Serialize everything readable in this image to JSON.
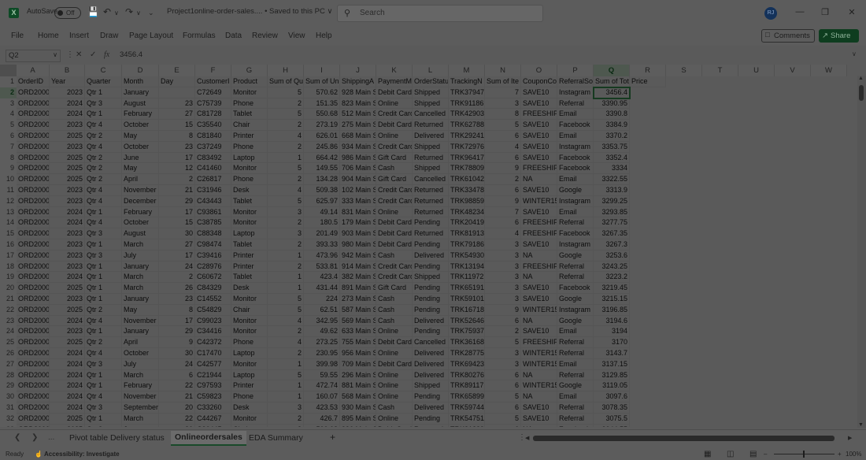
{
  "titlebar": {
    "autosave_label": "AutoSave",
    "autosave_state": "Off",
    "doc_title": "Project1online-order-sales.... • Saved to this PC ∨",
    "search_placeholder": "Search",
    "user_initials": "RJ"
  },
  "icons": {
    "excel": "excel-logo-icon",
    "save": "save-icon",
    "undo": "undo-icon",
    "redo": "redo-icon",
    "customize": "customize-quick-access-icon",
    "search": "search-icon",
    "minimize": "minimize-icon",
    "restore": "restore-icon",
    "close": "close-icon",
    "comments": "comment-icon",
    "share": "share-icon",
    "accessibility": "accessibility-icon"
  },
  "menu": [
    "File",
    "Home",
    "Insert",
    "Draw",
    "Page Layout",
    "Formulas",
    "Data",
    "Review",
    "View",
    "Help"
  ],
  "buttons": {
    "comments": "Comments",
    "share": "Share"
  },
  "formula_bar": {
    "name_box": "Q2",
    "formula": "3456.4",
    "fx": "fx"
  },
  "columns": [
    "A",
    "B",
    "C",
    "D",
    "E",
    "F",
    "G",
    "H",
    "I",
    "J",
    "K",
    "L",
    "M",
    "N",
    "O",
    "P",
    "Q",
    "R",
    "S",
    "T",
    "U",
    "V",
    "W"
  ],
  "selected_column": "Q",
  "selected_row": "2",
  "header_row": [
    "OrderID",
    "Year",
    "Quarter",
    "Month",
    "Day",
    "CustomerI",
    "Product",
    "Sum of Qu",
    "Sum of Un",
    "ShippingA",
    "PaymentM",
    "OrderStatu",
    "TrackingN",
    "Sum of Ite",
    "CouponCo",
    "ReferralSo",
    "Sum of Total",
    "Price"
  ],
  "rows": [
    [
      "ORD20000",
      "2023",
      "Qtr 1",
      "January",
      "",
      "C72649",
      "Monitor",
      "5",
      "570.62",
      "928 Main S",
      "Debit Card",
      "Shipped",
      "TRK37947",
      "7",
      "SAVE10",
      "Instagram",
      "3456.4"
    ],
    [
      "ORD20000",
      "2024",
      "Qtr 3",
      "August",
      "23",
      "C75739",
      "Phone",
      "2",
      "151.35",
      "823 Main S",
      "Online",
      "Shipped",
      "TRK91186",
      "3",
      "SAVE10",
      "Referral",
      "3390.95"
    ],
    [
      "ORD20000",
      "2024",
      "Qtr 1",
      "February",
      "27",
      "C81728",
      "Tablet",
      "5",
      "550.68",
      "512 Main S",
      "Credit Card",
      "Cancelled",
      "TRK42903",
      "8",
      "FREESHIP",
      "Email",
      "3390.8"
    ],
    [
      "ORD20000",
      "2023",
      "Qtr 4",
      "October",
      "15",
      "C35540",
      "Chair",
      "2",
      "273.19",
      "275 Main S",
      "Debit Card",
      "Returned",
      "TRK62788",
      "5",
      "SAVE10",
      "Facebook",
      "3384.9"
    ],
    [
      "ORD20000",
      "2025",
      "Qtr 2",
      "May",
      "8",
      "C81840",
      "Printer",
      "4",
      "626.01",
      "668 Main S",
      "Online",
      "Delivered",
      "TRK29241",
      "6",
      "SAVE10",
      "Email",
      "3370.2"
    ],
    [
      "ORD20000",
      "2023",
      "Qtr 4",
      "October",
      "23",
      "C37249",
      "Phone",
      "2",
      "245.86",
      "934 Main S",
      "Credit Card",
      "Shipped",
      "TRK72976",
      "4",
      "SAVE10",
      "Instagram",
      "3353.75"
    ],
    [
      "ORD20000",
      "2025",
      "Qtr 2",
      "June",
      "17",
      "C83492",
      "Laptop",
      "1",
      "664.42",
      "986 Main S",
      "Gift Card",
      "Returned",
      "TRK96417",
      "6",
      "SAVE10",
      "Facebook",
      "3352.4"
    ],
    [
      "ORD20000",
      "2025",
      "Qtr 2",
      "May",
      "12",
      "C41460",
      "Monitor",
      "5",
      "149.55",
      "706 Main S",
      "Cash",
      "Shipped",
      "TRK78809",
      "9",
      "FREESHIP",
      "Facebook",
      "3334"
    ],
    [
      "ORD20000",
      "2025",
      "Qtr 2",
      "April",
      "2",
      "C26817",
      "Phone",
      "2",
      "134.28",
      "904 Main S",
      "Gift Card",
      "Cancelled",
      "TRK61042",
      "2",
      "NA",
      "Email",
      "3322.55"
    ],
    [
      "ORD20000",
      "2023",
      "Qtr 4",
      "November",
      "21",
      "C31946",
      "Desk",
      "4",
      "509.38",
      "102 Main S",
      "Credit Card",
      "Returned",
      "TRK33478",
      "6",
      "SAVE10",
      "Google",
      "3313.9"
    ],
    [
      "ORD20001",
      "2023",
      "Qtr 4",
      "December",
      "29",
      "C43443",
      "Tablet",
      "5",
      "625.97",
      "333 Main S",
      "Credit Card",
      "Returned",
      "TRK98859",
      "9",
      "WINTER15",
      "Instagram",
      "3299.25"
    ],
    [
      "ORD20001",
      "2024",
      "Qtr 1",
      "February",
      "17",
      "C93861",
      "Monitor",
      "3",
      "49.14",
      "831 Main S",
      "Online",
      "Returned",
      "TRK48234",
      "7",
      "SAVE10",
      "Email",
      "3293.85"
    ],
    [
      "ORD20001",
      "2024",
      "Qtr 4",
      "October",
      "15",
      "C38785",
      "Monitor",
      "2",
      "180.5",
      "179 Main S",
      "Debit Card",
      "Pending",
      "TRK20419",
      "6",
      "FREESHIP",
      "Referral",
      "3277.75"
    ],
    [
      "ORD20001",
      "2023",
      "Qtr 3",
      "August",
      "30",
      "C88348",
      "Laptop",
      "3",
      "201.49",
      "903 Main S",
      "Debit Card",
      "Returned",
      "TRK81913",
      "4",
      "FREESHIP",
      "Facebook",
      "3267.35"
    ],
    [
      "ORD20001",
      "2023",
      "Qtr 1",
      "March",
      "27",
      "C98474",
      "Tablet",
      "2",
      "393.33",
      "980 Main S",
      "Debit Card",
      "Pending",
      "TRK79186",
      "3",
      "SAVE10",
      "Instagram",
      "3267.3"
    ],
    [
      "ORD20001",
      "2023",
      "Qtr 3",
      "July",
      "17",
      "C39416",
      "Printer",
      "1",
      "473.96",
      "942 Main S",
      "Cash",
      "Delivered",
      "TRK54930",
      "3",
      "NA",
      "Google",
      "3253.6"
    ],
    [
      "ORD20001",
      "2023",
      "Qtr 1",
      "January",
      "24",
      "C28976",
      "Printer",
      "2",
      "533.81",
      "914 Main S",
      "Credit Card",
      "Pending",
      "TRK13194",
      "3",
      "FREESHIP",
      "Referral",
      "3243.25"
    ],
    [
      "ORD20001",
      "2024",
      "Qtr 1",
      "March",
      "2",
      "C60672",
      "Tablet",
      "1",
      "423.4",
      "382 Main S",
      "Credit Card",
      "Shipped",
      "TRK11972",
      "3",
      "NA",
      "Referral",
      "3223.2"
    ],
    [
      "ORD20001",
      "2025",
      "Qtr 1",
      "March",
      "26",
      "C84329",
      "Desk",
      "1",
      "431.44",
      "891 Main S",
      "Gift Card",
      "Pending",
      "TRK65191",
      "3",
      "SAVE10",
      "Facebook",
      "3219.45"
    ],
    [
      "ORD20001",
      "2023",
      "Qtr 1",
      "January",
      "23",
      "C14552",
      "Monitor",
      "5",
      "224",
      "273 Main S",
      "Cash",
      "Pending",
      "TRK59101",
      "3",
      "SAVE10",
      "Google",
      "3215.15"
    ],
    [
      "ORD20002",
      "2025",
      "Qtr 2",
      "May",
      "8",
      "C54829",
      "Chair",
      "5",
      "62.51",
      "587 Main S",
      "Cash",
      "Pending",
      "TRK16718",
      "9",
      "WINTER15",
      "Instagram",
      "3196.85"
    ],
    [
      "ORD20002",
      "2024",
      "Qtr 4",
      "November",
      "17",
      "C99023",
      "Monitor",
      "4",
      "342.95",
      "569 Main S",
      "Cash",
      "Delivered",
      "TRK52646",
      "6",
      "NA",
      "Google",
      "3194.6"
    ],
    [
      "ORD20002",
      "2023",
      "Qtr 1",
      "January",
      "29",
      "C34416",
      "Monitor",
      "2",
      "49.62",
      "633 Main S",
      "Online",
      "Pending",
      "TRK75937",
      "2",
      "SAVE10",
      "Email",
      "3194"
    ],
    [
      "ORD20002",
      "2025",
      "Qtr 2",
      "April",
      "9",
      "C42372",
      "Phone",
      "4",
      "273.25",
      "755 Main S",
      "Debit Card",
      "Cancelled",
      "TRK36168",
      "5",
      "FREESHIP",
      "Referral",
      "3170"
    ],
    [
      "ORD20002",
      "2024",
      "Qtr 4",
      "October",
      "30",
      "C17470",
      "Laptop",
      "2",
      "230.95",
      "956 Main S",
      "Online",
      "Delivered",
      "TRK28775",
      "3",
      "WINTER15",
      "Referral",
      "3143.7"
    ],
    [
      "ORD20002",
      "2024",
      "Qtr 3",
      "July",
      "24",
      "C42577",
      "Monitor",
      "1",
      "399.98",
      "709 Main S",
      "Debit Card",
      "Delivered",
      "TRK69423",
      "3",
      "WINTER15",
      "Email",
      "3137.15"
    ],
    [
      "ORD20002",
      "2024",
      "Qtr 1",
      "March",
      "6",
      "C21944",
      "Laptop",
      "5",
      "59.55",
      "296 Main S",
      "Online",
      "Delivered",
      "TRK80276",
      "6",
      "NA",
      "Referral",
      "3129.85"
    ],
    [
      "ORD20002",
      "2024",
      "Qtr 1",
      "February",
      "22",
      "C97593",
      "Printer",
      "1",
      "472.74",
      "881 Main S",
      "Online",
      "Shipped",
      "TRK89117",
      "6",
      "WINTER15",
      "Google",
      "3119.05"
    ],
    [
      "ORD20002",
      "2024",
      "Qtr 4",
      "November",
      "21",
      "C59823",
      "Phone",
      "1",
      "160.07",
      "568 Main S",
      "Online",
      "Pending",
      "TRK65899",
      "5",
      "NA",
      "Email",
      "3097.6"
    ],
    [
      "ORD20002",
      "2024",
      "Qtr 3",
      "September",
      "20",
      "C33260",
      "Desk",
      "3",
      "423.53",
      "930 Main S",
      "Cash",
      "Delivered",
      "TRK59744",
      "6",
      "SAVE10",
      "Referral",
      "3078.35"
    ],
    [
      "ORD20003",
      "2025",
      "Qtr 1",
      "March",
      "22",
      "C44267",
      "Monitor",
      "2",
      "426.7",
      "895 Main S",
      "Online",
      "Pending",
      "TRK54751",
      "5",
      "SAVE10",
      "Referral",
      "3075.5"
    ],
    [
      "ORD20003",
      "2025",
      "Qtr 2",
      "June",
      "30",
      "C26445",
      "Chair",
      "3",
      "500.08",
      "996 Main S",
      "Debit Card",
      "Returned",
      "TRK31239",
      "6",
      "NA",
      "Facebook",
      "3044.55"
    ]
  ],
  "sheet_tabs": [
    "Pivot table Delivery status",
    "Onlineordersales",
    "EDA Summary"
  ],
  "active_tab": "Onlineordersales",
  "tab_add": "+",
  "tab_more": "...",
  "status": {
    "ready": "Ready",
    "accessibility": "Accessibility: Investigate",
    "zoom": "100%"
  }
}
